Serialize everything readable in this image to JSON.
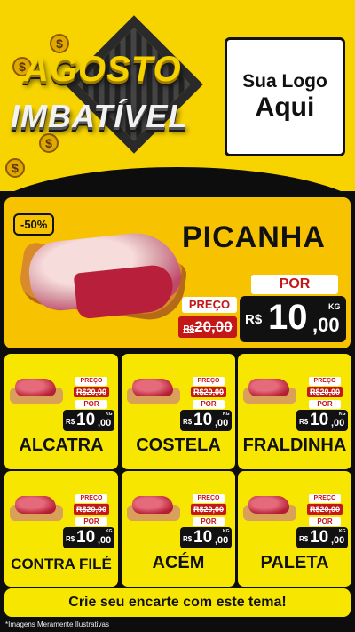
{
  "header": {
    "title_line1": "AGOSTO",
    "title_line2": "IMBATÍVEL",
    "logo_line1": "Sua Logo",
    "logo_line2": "Aqui",
    "coin_symbol": "$"
  },
  "hero": {
    "discount": "-50%",
    "name": "PICANHA",
    "price_label": "PREÇO",
    "old_currency": "R$",
    "old_price": "20,00",
    "por_label": "POR",
    "currency": "R$",
    "price_int": "10",
    "price_dec": ",00",
    "unit": "KG"
  },
  "products": [
    {
      "name": "ALCATRA",
      "price_label": "PREÇO",
      "old_currency": "R$",
      "old_price": "20,00",
      "por_label": "POR",
      "currency": "R$",
      "price_int": "10",
      "price_dec": ",00",
      "unit": "KG"
    },
    {
      "name": "COSTELA",
      "price_label": "PREÇO",
      "old_currency": "R$",
      "old_price": "20,00",
      "por_label": "POR",
      "currency": "R$",
      "price_int": "10",
      "price_dec": ",00",
      "unit": "KG"
    },
    {
      "name": "FRALDINHA",
      "price_label": "PREÇO",
      "old_currency": "R$",
      "old_price": "20,00",
      "por_label": "POR",
      "currency": "R$",
      "price_int": "10",
      "price_dec": ",00",
      "unit": "KG"
    },
    {
      "name": "CONTRA FILÉ",
      "price_label": "PREÇO",
      "old_currency": "R$",
      "old_price": "20,00",
      "por_label": "POR",
      "currency": "R$",
      "price_int": "10",
      "price_dec": ",00",
      "unit": "KG"
    },
    {
      "name": "ACÉM",
      "price_label": "PREÇO",
      "old_currency": "R$",
      "old_price": "20,00",
      "por_label": "POR",
      "currency": "R$",
      "price_int": "10",
      "price_dec": ",00",
      "unit": "KG"
    },
    {
      "name": "PALETA",
      "price_label": "PREÇO",
      "old_currency": "R$",
      "old_price": "20,00",
      "por_label": "POR",
      "currency": "R$",
      "price_int": "10",
      "price_dec": ",00",
      "unit": "KG"
    }
  ],
  "footer": {
    "cta": "Crie seu encarte com este tema!",
    "disclaimer": "*Imagens Meramente Ilustrativas"
  },
  "colors": {
    "yellow": "#f7d400",
    "card_yellow": "#f7e700",
    "hero_orange": "#f7c300",
    "red": "#c41818",
    "black": "#0d0d0d"
  }
}
